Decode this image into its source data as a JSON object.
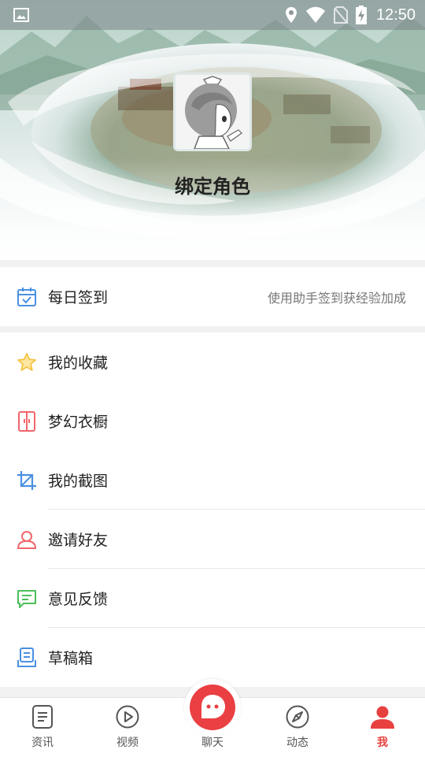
{
  "status_bar": {
    "time": "12:50",
    "icons": [
      "gallery-icon",
      "location-icon",
      "wifi-icon",
      "no-sim-icon",
      "battery-charging-icon"
    ]
  },
  "profile": {
    "bind_role_label": "绑定角色",
    "avatar": "default-avatar"
  },
  "daily_checkin": {
    "label": "每日签到",
    "hint": "使用助手签到获经验加成",
    "icon": "calendar-check-icon",
    "color": "#4a90e2"
  },
  "menu_items": [
    {
      "label": "我的收藏",
      "icon": "star-icon",
      "color": "#f5c342"
    },
    {
      "label": "梦幻衣橱",
      "icon": "wardrobe-icon",
      "color": "#f0666a"
    },
    {
      "label": "我的截图",
      "icon": "crop-icon",
      "color": "#4a90e2"
    },
    {
      "label": "邀请好友",
      "icon": "user-icon",
      "color": "#f0666a"
    },
    {
      "label": "意见反馈",
      "icon": "feedback-icon",
      "color": "#4cbf5a"
    },
    {
      "label": "草稿箱",
      "icon": "drafts-icon",
      "color": "#4a90e2"
    }
  ],
  "bottom_nav": {
    "items": [
      {
        "label": "资讯",
        "icon": "news-icon"
      },
      {
        "label": "视频",
        "icon": "video-play-icon"
      },
      {
        "label": "聊天",
        "icon": "chat-icon"
      },
      {
        "label": "动态",
        "icon": "compass-icon"
      },
      {
        "label": "我",
        "icon": "profile-icon",
        "active": true
      }
    ],
    "active_color": "#e8403f"
  }
}
